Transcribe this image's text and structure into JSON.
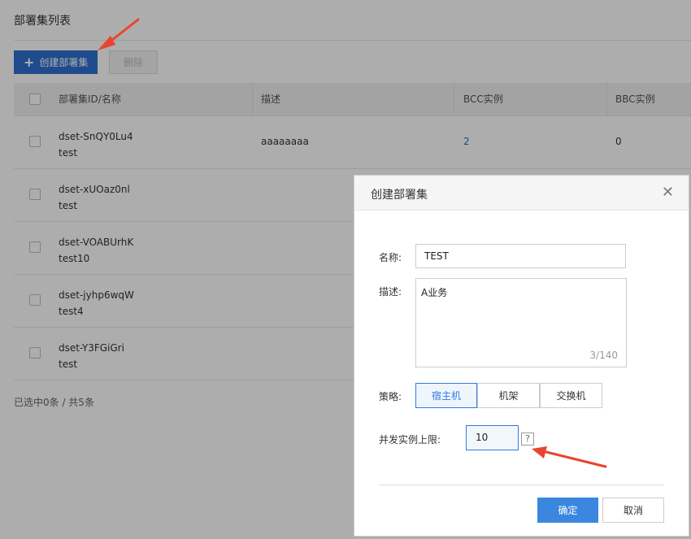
{
  "page": {
    "title": "部署集列表",
    "create_button": "创建部署集",
    "delete_button": "删除",
    "footer": "已选中0条 / 共5条"
  },
  "table": {
    "headers": [
      "部署集ID/名称",
      "描述",
      "BCC实例",
      "BBC实例"
    ],
    "rows": [
      {
        "id": "dset-SnQY0Lu4",
        "name": "test",
        "desc": "aaaaaaaa",
        "bcc": "2",
        "bbc": "0"
      },
      {
        "id": "dset-xUOaz0nl",
        "name": "test",
        "desc": "",
        "bcc": "",
        "bbc": ""
      },
      {
        "id": "dset-VOABUrhK",
        "name": "test10",
        "desc": "",
        "bcc": "",
        "bbc": ""
      },
      {
        "id": "dset-jyhp6wqW",
        "name": "test4",
        "desc": "",
        "bcc": "",
        "bbc": ""
      },
      {
        "id": "dset-Y3FGiGri",
        "name": "test",
        "desc": "",
        "bcc": "",
        "bbc": ""
      }
    ]
  },
  "modal": {
    "title": "创建部署集",
    "close_icon": "close-icon",
    "name_label": "名称:",
    "name_value": "TEST",
    "desc_label": "描述:",
    "desc_value": "A业务",
    "desc_counter": "3/140",
    "strategy_label": "策略:",
    "strategy_options": [
      "宿主机",
      "机架",
      "交换机"
    ],
    "strategy_selected": "宿主机",
    "limit_label": "并发实例上限:",
    "limit_value": "10",
    "help_icon": "?",
    "ok_button": "确定",
    "cancel_button": "取消"
  },
  "colors": {
    "primary": "#2f6fd0",
    "accent": "#3b87e0",
    "annotation_arrow": "#e8452f"
  }
}
